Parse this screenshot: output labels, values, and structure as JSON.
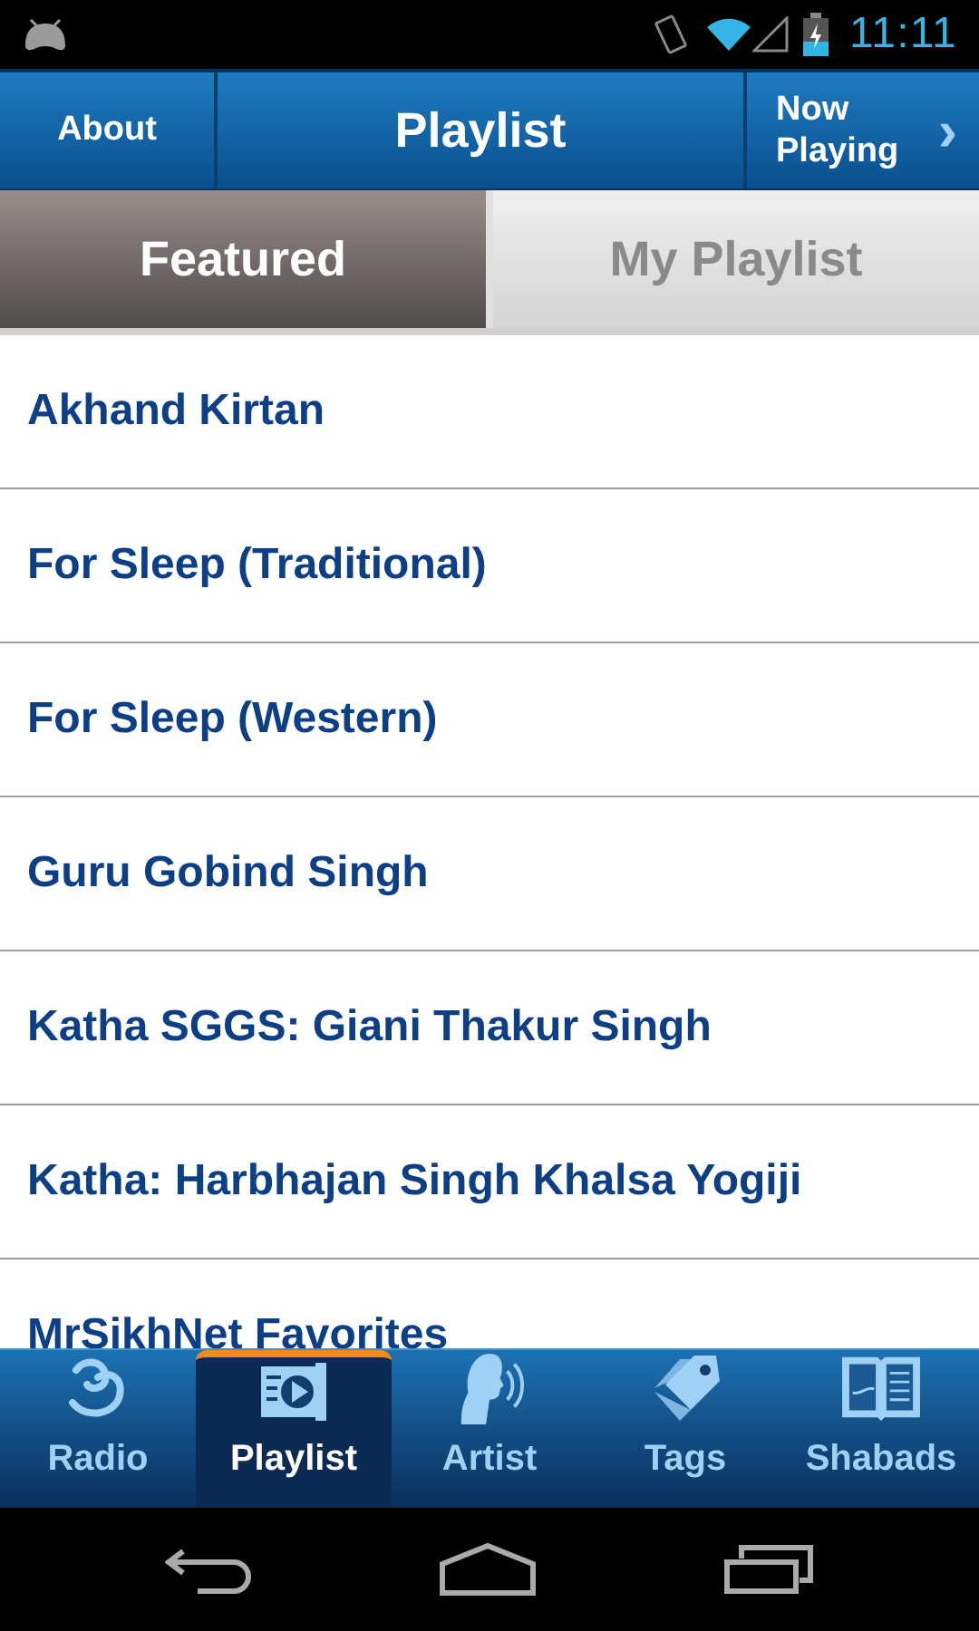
{
  "status_bar": {
    "time": "11:11"
  },
  "header": {
    "left_button": "About",
    "title": "Playlist",
    "right_button": "Now Playing",
    "right_arrow": "›"
  },
  "tabs": [
    {
      "label": "Featured",
      "selected": true
    },
    {
      "label": "My Playlist",
      "selected": false
    }
  ],
  "playlists": [
    {
      "name": "Akhand Kirtan"
    },
    {
      "name": "For Sleep (Traditional)"
    },
    {
      "name": "For Sleep (Western)"
    },
    {
      "name": "Guru Gobind Singh"
    },
    {
      "name": "Katha SGGS: Giani Thakur Singh"
    },
    {
      "name": "Katha: Harbhajan Singh Khalsa Yogiji"
    },
    {
      "name": "MrSikhNet Favorites"
    }
  ],
  "bottom_tabs": [
    {
      "label": "Radio",
      "kind": "radio",
      "selected": false
    },
    {
      "label": "Playlist",
      "kind": "playlist",
      "selected": true
    },
    {
      "label": "Artist",
      "kind": "artist",
      "selected": false
    },
    {
      "label": "Tags",
      "kind": "tags",
      "selected": false
    },
    {
      "label": "Shabads",
      "kind": "shabads",
      "selected": false
    }
  ]
}
